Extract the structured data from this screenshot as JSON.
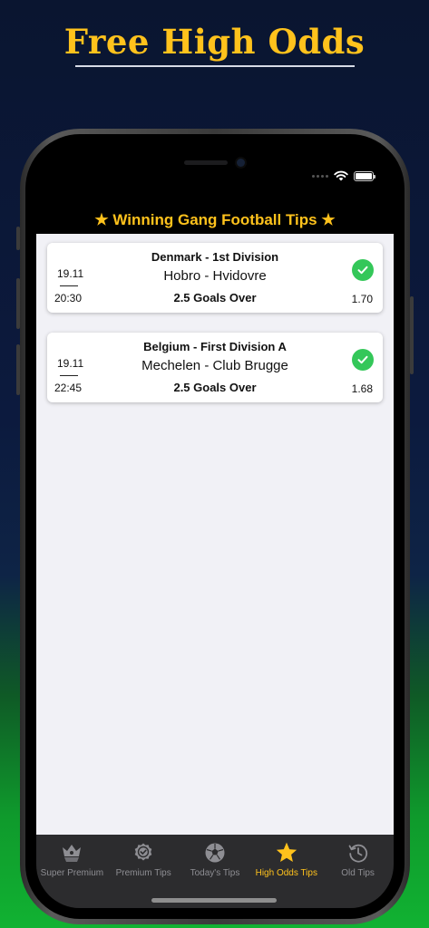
{
  "banner": {
    "title": "Free High Odds"
  },
  "app": {
    "title": "★ Winning Gang Football Tips ★",
    "accent_color": "#ffc21c"
  },
  "tips": [
    {
      "league": "Denmark - 1st Division",
      "match": "Hobro - Hvidovre",
      "tip": "2.5 Goals Over",
      "date": "19.11",
      "time": "20:30",
      "odds": "1.70",
      "status_icon": "check-circle-icon"
    },
    {
      "league": "Belgium - First Division A",
      "match": "Mechelen - Club Brugge",
      "tip": "2.5 Goals Over",
      "date": "19.11",
      "time": "22:45",
      "odds": "1.68",
      "status_icon": "check-circle-icon"
    }
  ],
  "tabs": [
    {
      "label": "Super Premium",
      "icon": "crown-badge-icon"
    },
    {
      "label": "Premium Tips",
      "icon": "seal-check-icon"
    },
    {
      "label": "Today's Tips",
      "icon": "soccer-ball-icon"
    },
    {
      "label": "High Odds Tips",
      "icon": "star-icon",
      "active": true
    },
    {
      "label": "Old Tips",
      "icon": "history-clock-icon"
    }
  ]
}
